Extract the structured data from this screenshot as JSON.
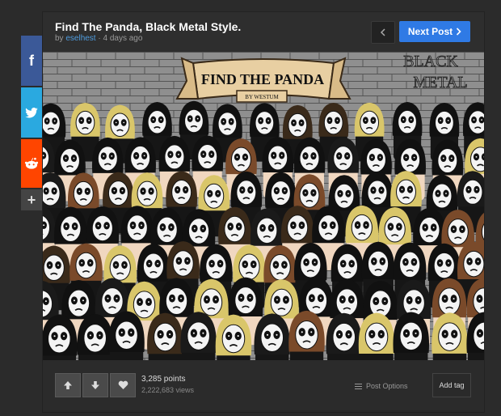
{
  "post": {
    "title": "Find The Panda, Black Metal Style.",
    "by_prefix": "by",
    "author": "eselhest",
    "time_ago": "· 4 days ago",
    "next_label": "Next Post",
    "points": "3,285 points",
    "views": "2,222,683 views",
    "options_label": "Post Options",
    "add_tag_label": "Add tag"
  },
  "image": {
    "banner_text": "FIND THE PANDA",
    "sub_text": "BY WESTUM",
    "corner_text_1": "BLACK",
    "corner_text_2": "METAL"
  },
  "share": {
    "facebook": "f",
    "twitter": "twitter-icon",
    "reddit": "reddit-icon",
    "more": "+"
  },
  "colors": {
    "accent": "#2f7ae5",
    "facebook": "#3b5998",
    "twitter": "#2aa9e0",
    "reddit": "#ff4500"
  }
}
